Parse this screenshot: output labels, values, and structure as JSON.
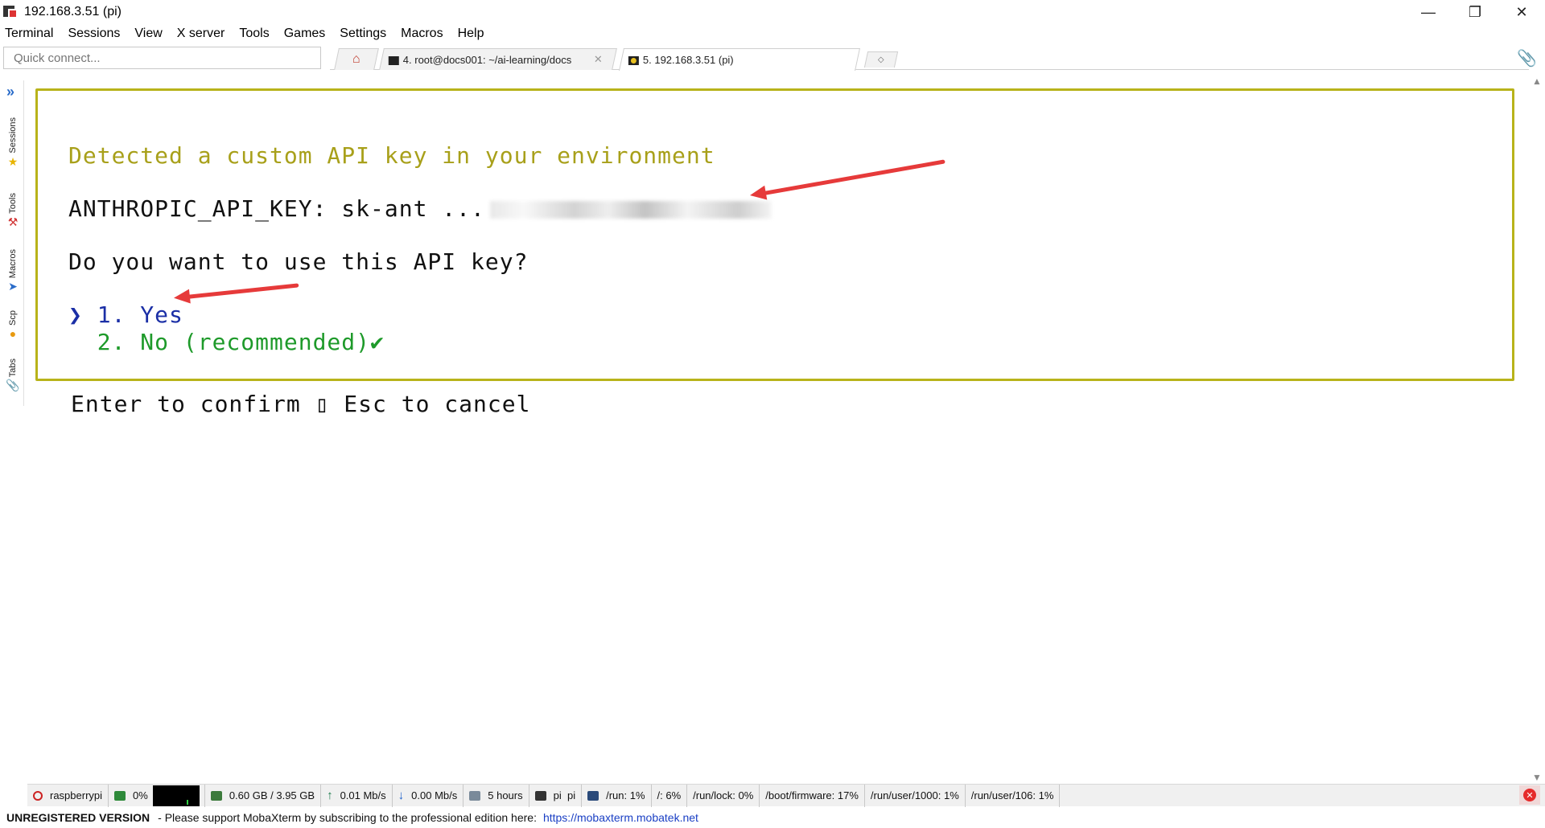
{
  "window": {
    "title": "192.168.3.51 (pi)",
    "controls": {
      "minimize": "—",
      "restore": "❐",
      "close": "✕"
    }
  },
  "menu": [
    "Terminal",
    "Sessions",
    "View",
    "X server",
    "Tools",
    "Games",
    "Settings",
    "Macros",
    "Help"
  ],
  "quick_connect": {
    "placeholder": "Quick connect..."
  },
  "tabs": [
    {
      "label": "4. root@docs001: ~/ai-learning/docs",
      "icon": "terminal-icon"
    },
    {
      "label": "5. 192.168.3.51 (pi)",
      "icon": "raspberry-pi-icon",
      "active": true
    }
  ],
  "sidebar": {
    "items": [
      {
        "label": "Sessions",
        "icon": "star-icon"
      },
      {
        "label": "Tools",
        "icon": "tools-icon"
      },
      {
        "label": "Macros",
        "icon": "macros-icon"
      },
      {
        "label": "Scp",
        "icon": "scp-icon"
      },
      {
        "label": "Tabs",
        "icon": "paperclip-icon"
      }
    ]
  },
  "terminal": {
    "detected": "Detected a custom API key in your environment",
    "api_key_label": "ANTHROPIC_API_KEY: sk-ant ...",
    "question": "Do you want to use this API key?",
    "option_yes": "❯ 1. Yes",
    "option_no": "  2. No (recommended)✔",
    "footer": "Enter to confirm ▯ Esc to cancel"
  },
  "statusbar": {
    "host": "raspberrypi",
    "cpu": "0%",
    "memory": "0.60 GB / 3.95 GB",
    "upload": "0.01 Mb/s",
    "download": "0.00 Mb/s",
    "uptime": "5 hours",
    "users": "pi  pi",
    "disk_run": "/run: 1%",
    "disk_root": "/: 6%",
    "disk_runlock": "/run/lock: 0%",
    "disk_firmware": "/boot/firmware: 17%",
    "disk_user1000": "/run/user/1000: 1%",
    "disk_user106": "/run/user/106: 1%"
  },
  "banner": {
    "unregistered": "UNREGISTERED VERSION",
    "message": "-  Please support MobaXterm by subscribing to the professional edition here:",
    "link": "https://mobaxterm.mobatek.net"
  },
  "colors": {
    "dialog_border": "#b8b31a",
    "detected_text": "#a8a01a",
    "yes_text": "#1b2fa6",
    "no_text": "#1e9a2a",
    "annotation_arrow": "#e63a3a"
  }
}
